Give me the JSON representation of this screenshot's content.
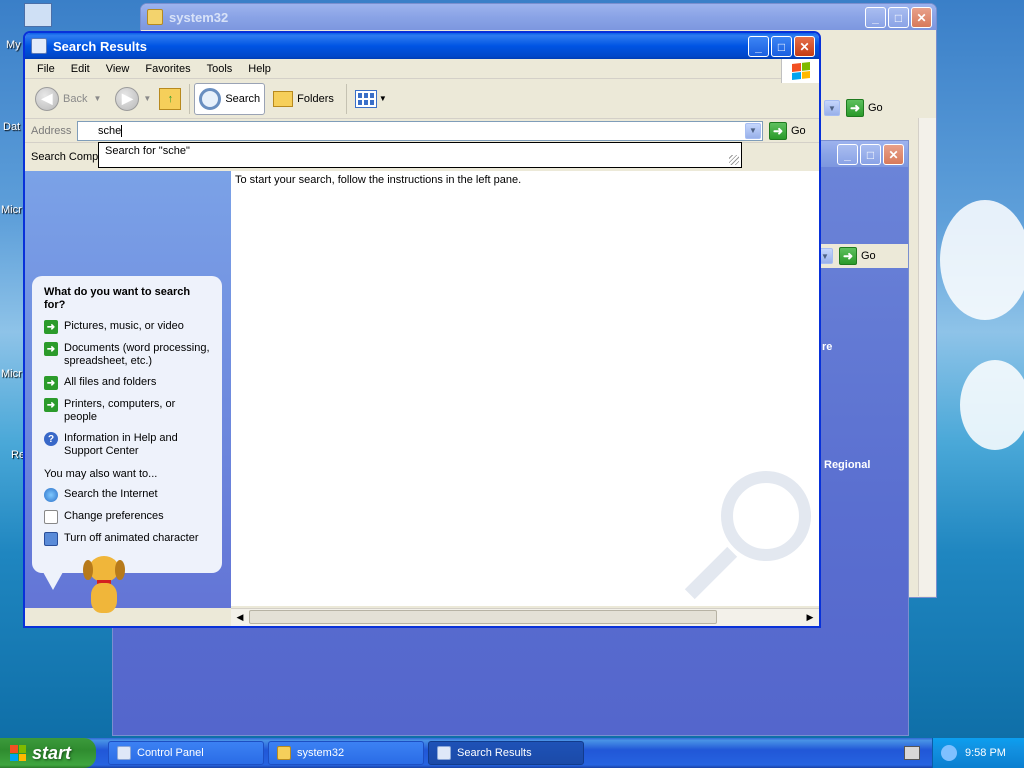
{
  "desktop": {
    "icons": [
      "My",
      "Dat",
      "Micr",
      "Micr",
      "Re"
    ],
    "peek_texts": {
      "re": "re",
      "regional": "Regional"
    }
  },
  "system32_window": {
    "title": "system32",
    "go_label": "Go"
  },
  "control_panel_window": {
    "go_label": "Go"
  },
  "search_window": {
    "title": "Search Results",
    "menu": [
      "File",
      "Edit",
      "View",
      "Favorites",
      "Tools",
      "Help"
    ],
    "toolbar": {
      "back_label": "Back",
      "search_label": "Search",
      "folders_label": "Folders"
    },
    "address": {
      "label": "Address",
      "value": "sche",
      "go_label": "Go"
    },
    "autocomplete": "Search for \"sche\"",
    "search_companion_label": "Search Compa",
    "instructions": "To start your search, follow the instructions in the left pane.",
    "companion": {
      "heading": "What do you want to search for?",
      "options": [
        {
          "label": "Pictures, music, or video",
          "icon": "arrow"
        },
        {
          "label": "Documents (word processing, spreadsheet, etc.)",
          "icon": "arrow"
        },
        {
          "label": "All files and folders",
          "icon": "arrow"
        },
        {
          "label": "Printers, computers, or people",
          "icon": "arrow"
        },
        {
          "label": "Information in Help and Support Center",
          "icon": "help"
        }
      ],
      "also_label": "You may also want to...",
      "also_options": [
        {
          "label": "Search the Internet",
          "icon": "globe"
        },
        {
          "label": "Change preferences",
          "icon": "pref"
        },
        {
          "label": "Turn off animated character",
          "icon": "monitor"
        }
      ]
    }
  },
  "taskbar": {
    "start_label": "start",
    "tasks": [
      "Control Panel",
      "system32",
      "Search Results"
    ],
    "clock": "9:58 PM"
  },
  "colors": {
    "xp_blue": "#0054e3",
    "companion_bg": "#7ba2e7",
    "start_green": "#2f8c2f"
  }
}
